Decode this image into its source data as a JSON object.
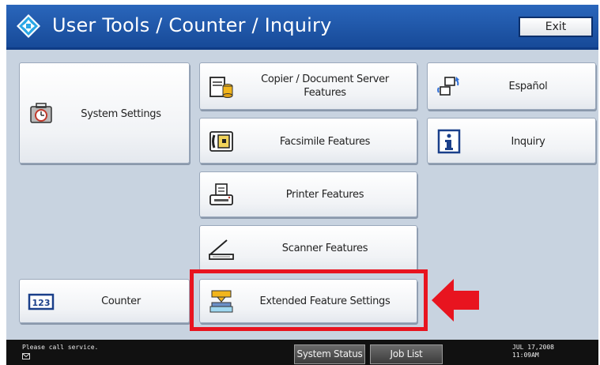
{
  "header": {
    "title": "User Tools / Counter / Inquiry",
    "exit_label": "Exit",
    "logo_icon": "diamond-arrows-icon"
  },
  "buttons": {
    "system_settings": {
      "label": "System Settings",
      "icon": "toolbox-clock-icon"
    },
    "counter": {
      "label": "Counter",
      "icon": "counter-123-icon"
    },
    "copier": {
      "line1": "Copier / Document Server",
      "line2": "Features",
      "icon": "copier-document-server-icon"
    },
    "facsimile": {
      "label": "Facsimile Features",
      "icon": "facsimile-icon"
    },
    "printer": {
      "label": "Printer Features",
      "icon": "printer-icon"
    },
    "scanner": {
      "label": "Scanner Features",
      "icon": "scanner-icon"
    },
    "extended": {
      "label": "Extended Feature Settings",
      "icon": "extended-feature-icon"
    },
    "espanol": {
      "label": "Español",
      "icon": "language-switch-icon"
    },
    "inquiry": {
      "label": "Inquiry",
      "icon": "info-icon"
    }
  },
  "annotation": {
    "highlight_color": "#e8141f",
    "arrow_icon": "red-left-arrow-icon"
  },
  "footer": {
    "message": "Please call service.",
    "system_status_label": "System Status",
    "job_list_label": "Job List",
    "date": "JUL  17,2008",
    "time": "11:09AM"
  },
  "colors": {
    "header_blue": "#1f57a8",
    "panel_bg": "#c8d3e0",
    "footer_bg": "#111111"
  }
}
